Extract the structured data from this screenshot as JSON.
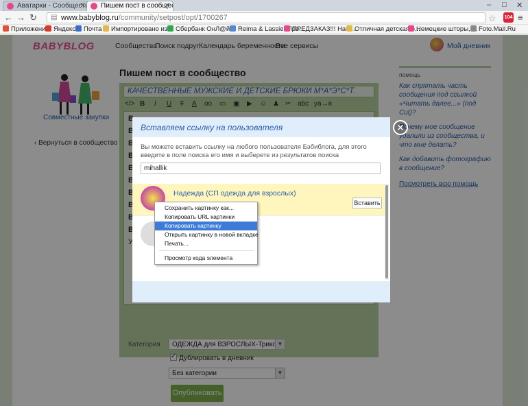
{
  "browser": {
    "tabs": [
      {
        "label": "Аватарки - Сообщество",
        "active": false
      },
      {
        "label": "Пишем пост в сообщество",
        "active": true
      }
    ],
    "url_host": "www.babyblog.ru",
    "url_path": "/community/setpost/opt/1700267",
    "ext_badge": "104",
    "bookmarks": [
      {
        "label": "Приложения",
        "icon": "apps-icon",
        "color": "#e0513b"
      },
      {
        "label": "Яндекс",
        "icon": "yandex-icon",
        "color": "#d83b2b"
      },
      {
        "label": "Почта",
        "icon": "mail-icon",
        "color": "#3a6fc0"
      },
      {
        "label": "Импортировано из...",
        "icon": "folder-icon",
        "color": "#e3b84a"
      },
      {
        "label": "Сбербанк ОнЛ@йн",
        "icon": "sberbank-icon",
        "color": "#2ea64d"
      },
      {
        "label": "Reima & Lassie. Пре...",
        "icon": "reima-icon",
        "color": "#5588cc"
      },
      {
        "label": "ПРЕДЗАКАЗ!!! Наст...",
        "icon": "babyblog-icon",
        "color": "#e24a8a"
      },
      {
        "label": "Отличная детская о...",
        "icon": "folder-icon",
        "color": "#e3b84a"
      },
      {
        "label": "Немецкие шторы, ...",
        "icon": "babyblog-icon",
        "color": "#e24a8a"
      },
      {
        "label": "Foto.Mail.Ru",
        "icon": "doc-icon",
        "color": "#888888"
      }
    ]
  },
  "site": {
    "logo": "BABYBLOG",
    "nav": [
      "Сообщества",
      "Поиск подруг",
      "Календарь беременности",
      "Все сервисы"
    ],
    "diary": "Мой дневник"
  },
  "left": {
    "caption": "Совместные закупки",
    "back": "Вернуться в сообщество"
  },
  "editor": {
    "page_title": "Пишем пост в сообщество",
    "subject": "КАЧЕСТВЕННЫЕ МУЖСКИЕ И ДЕТСКИЕ БРЮКИ М*А*Э*С*Т.",
    "toolbar": [
      "</>",
      "B",
      "I",
      "U",
      "T",
      "A",
      "oo",
      "▭",
      "▣",
      "▶",
      "☺",
      "♟",
      "✂",
      "abc",
      "ya→я"
    ],
    "lines": [
      "В",
      "В",
      "В",
      "В",
      "В",
      "В",
      "В",
      "В",
      "В",
      "В",
      "У"
    ],
    "category_label": "Категория",
    "category_value": "ОДЕЖДА для ВЗРОСЛЫХ-Трикотаж, Пов",
    "duplicate_label": "Дублировать в дневник",
    "subcategory_value": "Без категории",
    "publish": "Опубликовать"
  },
  "help": {
    "title": "помощь",
    "links": [
      "Как спрятать часть сообщения под ссылкой «Читать далее...» (под Cut)?",
      "Почему мое сообщение удалили из сообщества, и что мне делать?",
      "Как добавить фотографию в сообщение?"
    ],
    "all": "Посмотреть всю помощь"
  },
  "modal": {
    "title": "Вставляем ссылку на пользователя",
    "description": "Вы можете вставить ссылку на любого пользователя Бэбиблога, для этого введите в поле поиска его имя и выберете из результатов поиска",
    "input_value": "mihallik",
    "result_name": "Надежда (СП одежда для взрослых)",
    "insert": "Вставить",
    "close": "✕"
  },
  "context_menu": {
    "items": [
      "Сохранить картинку как...",
      "Копировать URL картинки",
      "Копировать картинку",
      "Открыть картинку в новой вкладке",
      "Печать...",
      "Просмотр кода элемента"
    ],
    "highlighted": "Копировать картинку"
  }
}
